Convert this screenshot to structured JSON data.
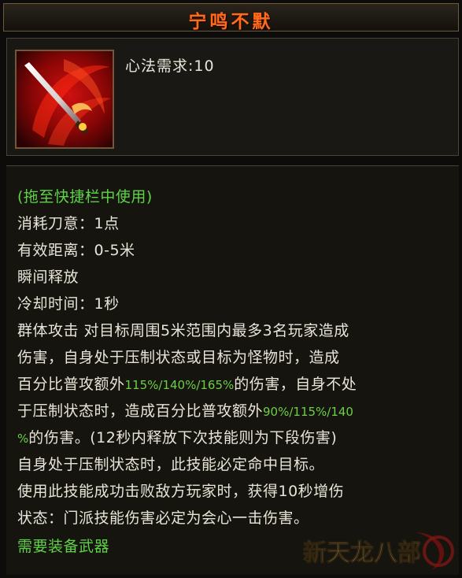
{
  "title": "宁鸣不默",
  "requirement": "心法需求:10",
  "usage_hint": "(拖至快捷栏中使用)",
  "stats": {
    "cost": "消耗刀意：1点",
    "range": "有效距离：0-5米",
    "cast": "瞬间释放",
    "cooldown": "冷却时间：1秒"
  },
  "description": {
    "l1": "群体攻击 对目标周围5米范围内最多3名玩家造成",
    "l2": "伤害，自身处于压制状态或目标为怪物时，造成",
    "l3_pre": "百分比普攻额外",
    "l3_pct": "115%/140%/165%",
    "l3_post": "的伤害，自身不处",
    "l4_pre": "于压制状态时，造成百分比普攻额外",
    "l4_pct": "90%/115%/140",
    "l5_pct": "%",
    "l5_post": "的伤害。(12秒内释放下次技能则为下段伤害)",
    "l6": "自身处于压制状态时，此技能必定命中目标。",
    "l7": "使用此技能成功击败敌方玩家时，获得10秒增伤",
    "l8": "状态：门派技能伤害必定为会心一击伤害。"
  },
  "weapon_req": "需要装备武器",
  "watermark": "新天龙八部",
  "colors": {
    "title": "#ff6a1e",
    "green": "#5fd24a",
    "text": "#e8e4d8"
  },
  "icons": {
    "skill": "crimson-blade-slash-icon"
  }
}
